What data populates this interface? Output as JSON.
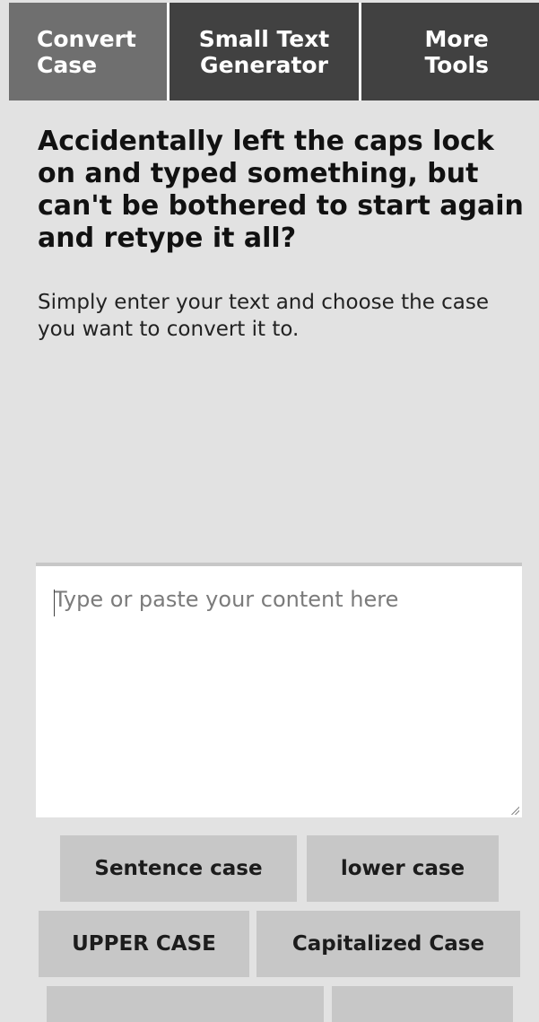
{
  "nav": {
    "convert_case": {
      "line1": "Convert",
      "line2": "Case"
    },
    "small_text": {
      "line1": "Small Text",
      "line2": "Generator"
    },
    "more_tools": {
      "line1": "More",
      "line2": "Tools"
    }
  },
  "intro": {
    "headline": "Accidentally left the caps lock on and typed something, but can't be bothered to start again and retype it all?",
    "lead": "Simply enter your text and choose the case you want to convert it to."
  },
  "editor": {
    "placeholder": "Type or paste your content here",
    "value": ""
  },
  "buttons": {
    "sentence_case": "Sentence case",
    "lower_case": "lower case",
    "upper_case": "UPPER CASE",
    "capitalized_case": "Capitalized Case"
  }
}
